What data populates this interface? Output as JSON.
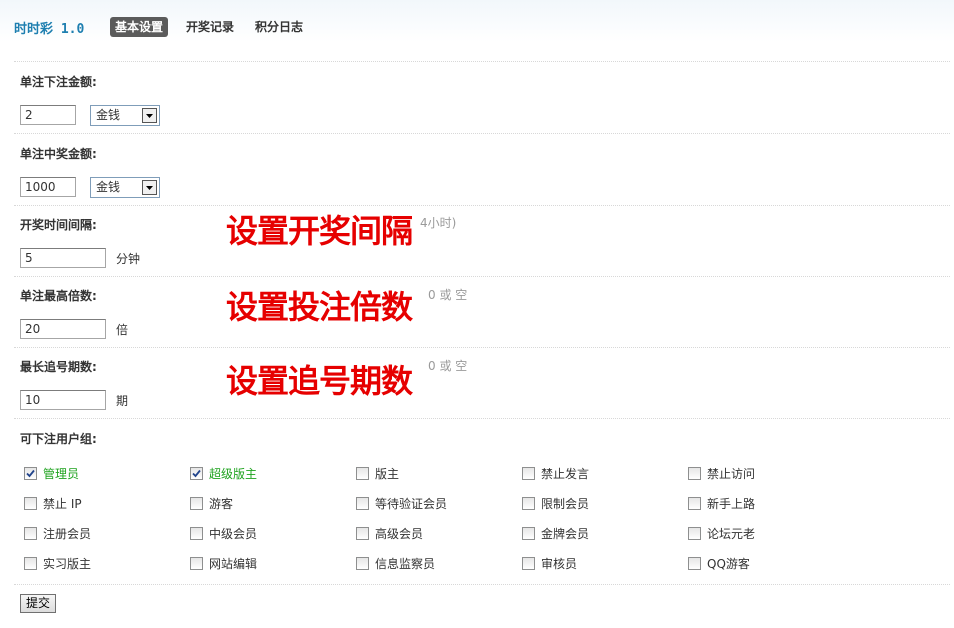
{
  "header": {
    "app_title": "时时彩 1.0",
    "tabs": [
      {
        "label": "基本设置",
        "active": true
      },
      {
        "label": "开奖记录",
        "active": false
      },
      {
        "label": "积分日志",
        "active": false
      }
    ]
  },
  "form": {
    "bet_amount": {
      "label": "单注下注金额:",
      "value": "2",
      "currency": "金钱"
    },
    "win_amount": {
      "label": "单注中奖金额:",
      "value": "1000",
      "currency": "金钱"
    },
    "interval": {
      "label": "开奖时间间隔:",
      "value": "5",
      "unit": "分钟",
      "hint": "4小时)"
    },
    "max_multiple": {
      "label": "单注最高倍数:",
      "value": "20",
      "unit": "倍",
      "hint": "0 或 空"
    },
    "max_periods": {
      "label": "最长追号期数:",
      "value": "10",
      "unit": "期",
      "hint": "0 或 空"
    },
    "groups_label": "可下注用户组:",
    "groups": [
      {
        "label": "管理员",
        "checked": true
      },
      {
        "label": "超级版主",
        "checked": true
      },
      {
        "label": "版主",
        "checked": false
      },
      {
        "label": "禁止发言",
        "checked": false
      },
      {
        "label": "禁止访问",
        "checked": false
      },
      {
        "label": "禁止 IP",
        "checked": false
      },
      {
        "label": "游客",
        "checked": false
      },
      {
        "label": "等待验证会员",
        "checked": false
      },
      {
        "label": "限制会员",
        "checked": false
      },
      {
        "label": "新手上路",
        "checked": false
      },
      {
        "label": "注册会员",
        "checked": false
      },
      {
        "label": "中级会员",
        "checked": false
      },
      {
        "label": "高级会员",
        "checked": false
      },
      {
        "label": "金牌会员",
        "checked": false
      },
      {
        "label": "论坛元老",
        "checked": false
      },
      {
        "label": "实习版主",
        "checked": false
      },
      {
        "label": "网站编辑",
        "checked": false
      },
      {
        "label": "信息监察员",
        "checked": false
      },
      {
        "label": "审核员",
        "checked": false
      },
      {
        "label": "QQ游客",
        "checked": false
      }
    ],
    "submit_label": "提交"
  },
  "annotations": {
    "interval_note": "设置开奖间隔",
    "multiple_note": "设置投注倍数",
    "periods_note": "设置追号期数"
  },
  "colors": {
    "checked_label": "#1fa31f",
    "overlay_text": "#e60000",
    "title": "#1e7fb0"
  }
}
